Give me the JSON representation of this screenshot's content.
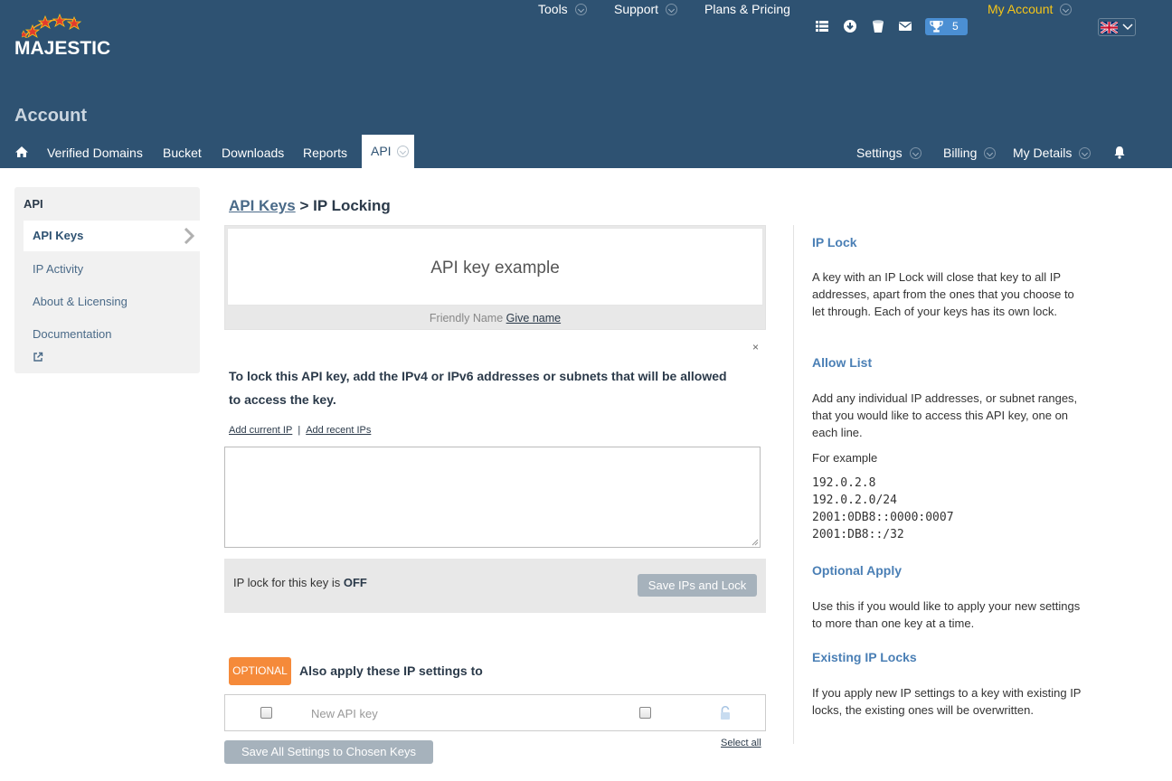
{
  "brand": {
    "name": "MAJESTIC"
  },
  "topnav": {
    "tools": "Tools",
    "support": "Support",
    "plans": "Plans & Pricing",
    "trophy_count": "5",
    "my_account": "My Account"
  },
  "header": {
    "title": "Account"
  },
  "subnav": {
    "verified_domains": "Verified Domains",
    "bucket": "Bucket",
    "downloads": "Downloads",
    "reports": "Reports",
    "api": "API",
    "settings": "Settings",
    "billing": "Billing",
    "my_details": "My Details"
  },
  "sidebar": {
    "title": "API",
    "items": [
      {
        "label": "API Keys"
      },
      {
        "label": "IP Activity"
      },
      {
        "label": "About & Licensing"
      },
      {
        "label": "Documentation"
      }
    ]
  },
  "breadcrumb": {
    "link": "API Keys",
    "separator": ">",
    "current": "IP Locking"
  },
  "key_box": {
    "title": "API key example",
    "friendly_label": "Friendly Name",
    "give_name": "Give name"
  },
  "close_label": "×",
  "instructions": "To lock this API key, add the IPv4 or IPv6 addresses or subnets that will be allowed to access the key.",
  "links": {
    "add_current": "Add current IP",
    "separator": "|",
    "add_recent": "Add recent IPs"
  },
  "ip_textarea": {
    "value": ""
  },
  "lock_status": {
    "prefix": "IP lock for this key is",
    "state": "OFF",
    "button": "Save IPs and Lock"
  },
  "optional": {
    "badge": "OPTIONAL",
    "heading": "Also apply these IP settings to",
    "row_label": "New API key",
    "select_all": "Select all",
    "save_all": "Save All Settings to Chosen Keys"
  },
  "help": {
    "ip_lock": {
      "title": "IP Lock",
      "text": "A key with an IP Lock will close that key to all IP addresses, apart from the ones that you choose to let through. Each of your keys has its own lock."
    },
    "allow_list": {
      "title": "Allow List",
      "text": "Add any individual IP addresses, or subnet ranges, that you would like to access this API key, one on each line.",
      "example_label": "For example",
      "examples": [
        "192.0.2.8",
        "192.0.2.0/24",
        "2001:0DB8::0000:0007",
        "2001:DB8::/32"
      ]
    },
    "optional_apply": {
      "title": "Optional Apply",
      "text": "Use this if you would like to apply your new settings to more than one key at a time."
    },
    "existing_locks": {
      "title": "Existing IP Locks",
      "text": "If you apply new IP settings to a key with existing IP locks, the existing ones will be overwritten."
    }
  },
  "colors": {
    "header_bg": "#2e5272",
    "accent_link": "#4a7fb5",
    "my_account": "#f5c518",
    "optional_badge": "#f58a3a",
    "button_grey": "#a6b2bc"
  }
}
